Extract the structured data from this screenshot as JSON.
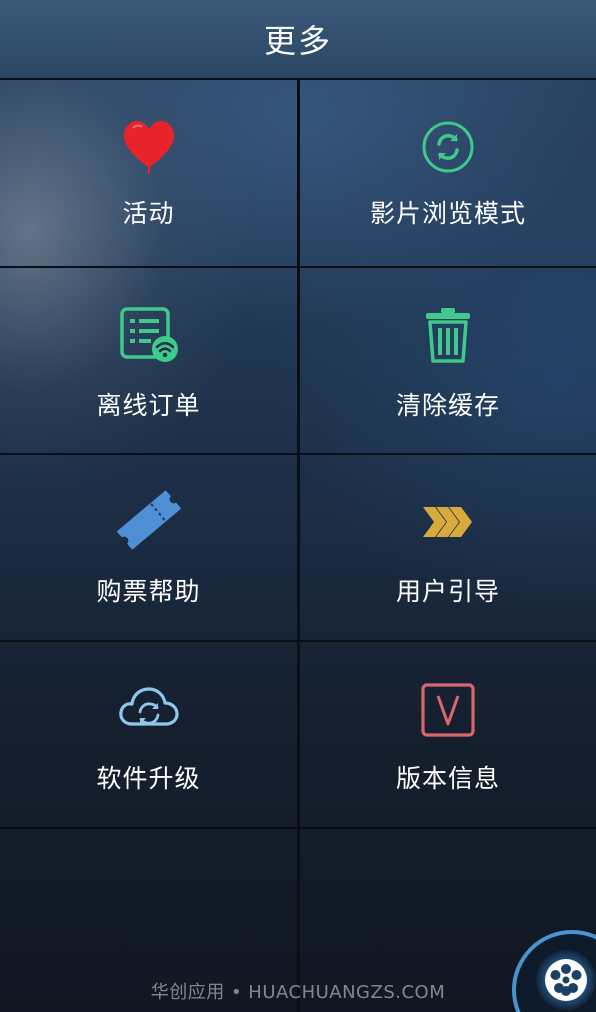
{
  "header": {
    "title": "更多"
  },
  "tiles": [
    {
      "label": "活动",
      "icon": "heart-icon",
      "color": "#e8232a"
    },
    {
      "label": "影片浏览模式",
      "icon": "refresh-icon",
      "color": "#3fc98a"
    },
    {
      "label": "离线订单",
      "icon": "offline-order-icon",
      "color": "#3fc98a"
    },
    {
      "label": "清除缓存",
      "icon": "trash-icon",
      "color": "#3fc98a"
    },
    {
      "label": "购票帮助",
      "icon": "ticket-icon",
      "color": "#4e8fd6"
    },
    {
      "label": "用户引导",
      "icon": "chevrons-right-icon",
      "color": "#d8aa3e"
    },
    {
      "label": "软件升级",
      "icon": "cloud-sync-icon",
      "color": "#8fc7ec"
    },
    {
      "label": "版本信息",
      "icon": "version-v-icon",
      "color": "#d7676c"
    }
  ],
  "footer": {
    "watermark": "华创应用 • HUACHUANGZS.COM"
  },
  "fab": {
    "icon": "film-reel-icon"
  }
}
